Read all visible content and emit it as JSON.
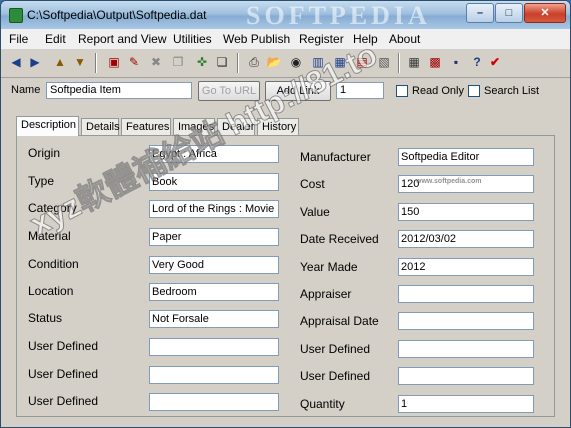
{
  "window": {
    "title": "C:\\Softpedia\\Output\\Softpedia.dat",
    "watermark_title": "SOFTPEDIA",
    "minimize": "–",
    "maximize": "□",
    "close": "✕"
  },
  "menu": [
    "File",
    "Edit",
    "Report and View",
    "Utilities",
    "Web Publish",
    "Register",
    "Help",
    "About"
  ],
  "toolbar": {
    "icons": [
      "first-record-icon",
      "last-record-icon",
      "up-icon",
      "down-icon",
      "add-record-icon",
      "edit-record-icon",
      "delete-record-icon",
      "copy-record-icon",
      "search-icon",
      "paste-icon",
      "print-icon",
      "open-folder-icon",
      "camera-icon",
      "chart-icon",
      "grid-icon",
      "list-icon",
      "report-icon",
      "calculator-icon",
      "calendar-icon",
      "save-icon",
      "help-icon",
      "check-icon"
    ],
    "glyphs": [
      "◀",
      "▶",
      "▲",
      "▼",
      "▣",
      "✎",
      "✖",
      "❐",
      "✜",
      "❏",
      "⎙",
      "📂",
      "◉",
      "▥",
      "▦",
      "▤",
      "▧",
      "▦",
      "▩",
      "▪",
      "?",
      "✔"
    ]
  },
  "namebar": {
    "name_label": "Name",
    "name_value": "Softpedia Item",
    "go_to_url": "Go To URL",
    "add_link": "Add Link",
    "link_number": "1",
    "read_only": "Read Only",
    "search_list": "Search List"
  },
  "tabs": [
    "Description",
    "Details",
    "Features",
    "Images",
    "Dealer",
    "History"
  ],
  "left_fields": [
    {
      "label": "Origin",
      "value": "Egypt  : Africa"
    },
    {
      "label": "Type",
      "value": "Book"
    },
    {
      "label": "Category",
      "value": "Lord of the Rings : Movie"
    },
    {
      "label": "Material",
      "value": "Paper"
    },
    {
      "label": "Condition",
      "value": "Very Good"
    },
    {
      "label": "Location",
      "value": "Bedroom"
    },
    {
      "label": "Status",
      "value": "Not Forsale"
    },
    {
      "label": "User Defined",
      "value": ""
    },
    {
      "label": "User Defined",
      "value": ""
    },
    {
      "label": "User Defined",
      "value": ""
    }
  ],
  "right_fields": [
    {
      "label": "Manufacturer",
      "value": "Softpedia Editor"
    },
    {
      "label": "Cost",
      "value": "120"
    },
    {
      "label": "Value",
      "value": "150"
    },
    {
      "label": "Date Received",
      "value": "2012/03/02"
    },
    {
      "label": "Year Made",
      "value": "2012"
    },
    {
      "label": "Appraiser",
      "value": ""
    },
    {
      "label": "Appraisal Date",
      "value": ""
    },
    {
      "label": "User Defined",
      "value": ""
    },
    {
      "label": "User Defined",
      "value": ""
    },
    {
      "label": "Quantity",
      "value": "1"
    }
  ],
  "watermarks": {
    "diagonal": "xyz軟體補給站 http://81.to",
    "small": "www.softpedia.com"
  }
}
